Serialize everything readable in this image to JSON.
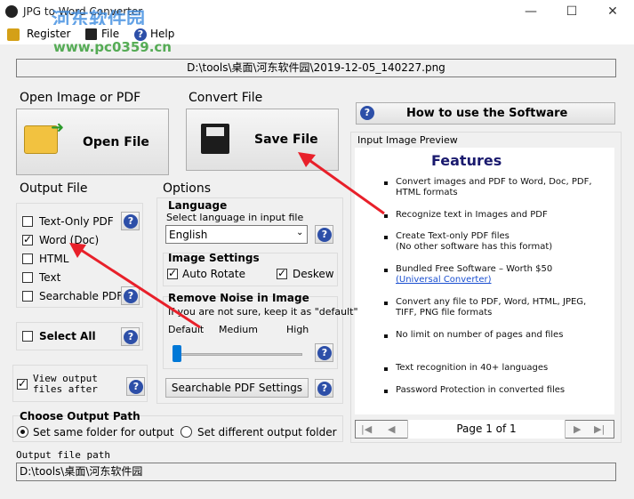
{
  "window": {
    "title": "JPG to Word Converter",
    "minimize": "—",
    "maximize": "☐",
    "close": "✕"
  },
  "watermark": {
    "name": "河东软件园",
    "url": "www.pc0359.cn"
  },
  "menu": {
    "register": "Register",
    "file": "File",
    "help": "Help"
  },
  "source_path": "D:\\tools\\桌面\\河东软件园\\2019-12-05_140227.png",
  "open_section": {
    "title": "Open Image or PDF",
    "button": "Open File"
  },
  "convert_section": {
    "title": "Convert File",
    "button": "Save File"
  },
  "howto_button": "How to use the Software",
  "preview": {
    "label": "Input Image Preview",
    "heading": "Features",
    "items": [
      "Convert images and PDF to Word, Doc, PDF, HTML formats",
      "Recognize text in Images and PDF",
      "Create Text-only PDF files\n(No other software has this format)",
      "Bundled Free Software – Worth $50",
      "Convert any file to PDF, Word, HTML, JPEG, TIFF, PNG file formats",
      "No limit on number of pages and files",
      "Text recognition in 40+ languages",
      "Password Protection in converted files"
    ],
    "link": "(Universal Converter)",
    "page_label": "Page 1 of 1",
    "nav": {
      "first": "|◀",
      "prev": "◀",
      "next": "▶",
      "last": "▶|"
    }
  },
  "output_file": {
    "title": "Output File",
    "options": [
      {
        "label": "Text-Only PDF",
        "checked": false
      },
      {
        "label": "Word (Doc)",
        "checked": true
      },
      {
        "label": "HTML",
        "checked": false
      },
      {
        "label": "Text",
        "checked": false
      },
      {
        "label": "Searchable PDF",
        "checked": false
      }
    ],
    "select_all": "Select All",
    "view_output": "View output\nfiles after",
    "view_output_checked": true
  },
  "options": {
    "title": "Options",
    "language_title": "Language",
    "language_hint": "Select language in input file",
    "language_value": "English",
    "image_settings_title": "Image Settings",
    "auto_rotate": "Auto Rotate",
    "auto_rotate_checked": true,
    "deskew": "Deskew",
    "deskew_checked": true,
    "noise_title": "Remove Noise in Image",
    "noise_hint": "If you are not sure, keep it as \"default\"",
    "noise_levels": [
      "Default",
      "Medium",
      "High"
    ],
    "noise_value": 0,
    "searchable_pdf_settings": "Searchable PDF Settings"
  },
  "output_path": {
    "title": "Choose Output Path",
    "same_folder": "Set same folder for output",
    "different_folder": "Set different output folder",
    "selected": "same",
    "label": "Output file path",
    "value": "D:\\tools\\桌面\\河东软件园"
  },
  "help_glyph": "?",
  "colors": {
    "accent": "#2d4fa8",
    "arrow": "#e8202a",
    "feature_heading": "#1a1a6e",
    "link": "#1a4fd0"
  }
}
